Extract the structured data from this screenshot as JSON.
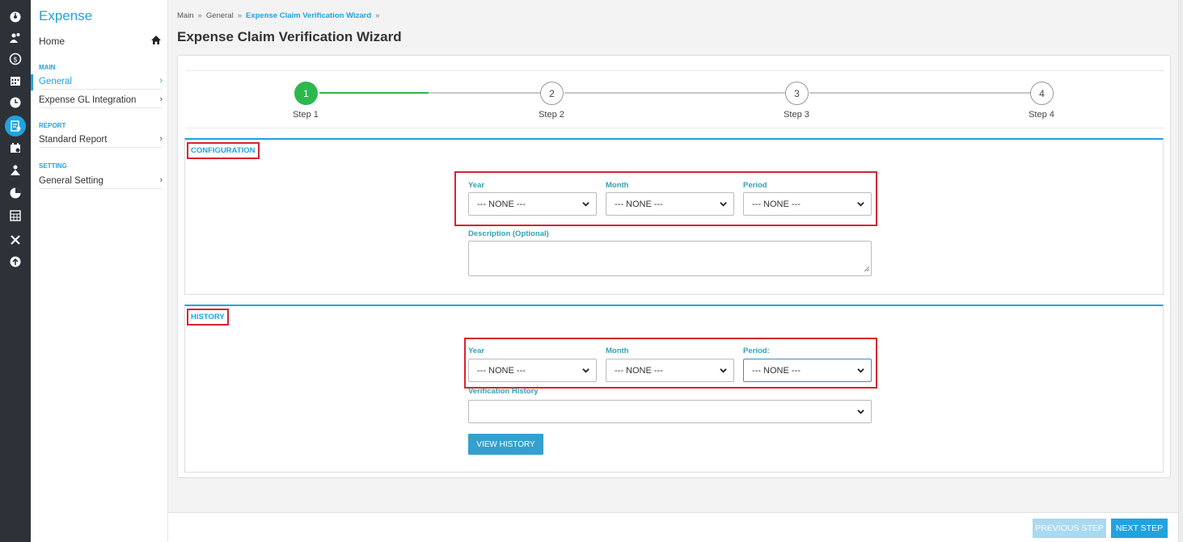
{
  "rail": {
    "icons": [
      "dashboard-icon",
      "users-icon",
      "money-icon",
      "calendar-icon",
      "clock-icon",
      "expense-claim-icon",
      "planner-icon",
      "org-icon",
      "chart-icon",
      "calculator-icon",
      "tools-icon",
      "upload-icon"
    ],
    "active_index": 5,
    "active_color": "#1fa3e0"
  },
  "menu": {
    "title": "Expense",
    "home": "Home",
    "sections": [
      {
        "heading": "MAIN",
        "items": [
          {
            "label": "General",
            "active": true
          },
          {
            "label": "Expense GL Integration"
          }
        ]
      },
      {
        "heading": "REPORT",
        "items": [
          {
            "label": "Standard Report"
          }
        ]
      },
      {
        "heading": "SETTING",
        "items": [
          {
            "label": "General Setting"
          }
        ]
      }
    ]
  },
  "breadcrumb": {
    "items": [
      "Main",
      "General",
      "Expense Claim Verification Wizard"
    ],
    "sep": "»"
  },
  "page_title": "Expense Claim Verification Wizard",
  "wizard": {
    "steps": [
      {
        "number": "1",
        "label": "Step 1",
        "active": true
      },
      {
        "number": "2",
        "label": "Step 2"
      },
      {
        "number": "3",
        "label": "Step 3"
      },
      {
        "number": "4",
        "label": "Step 4"
      }
    ],
    "progress_color": "#2db84d"
  },
  "configuration": {
    "title": "CONFIGURATION",
    "year_label": "Year",
    "month_label": "Month",
    "period_label": "Period",
    "year_value": "--- NONE ---",
    "month_value": "--- NONE ---",
    "period_value": "--- NONE ---",
    "description_label": "Description (Optional)"
  },
  "history": {
    "title": "HISTORY",
    "year_label": "Year",
    "month_label": "Month",
    "period_label": "Period:",
    "year_value": "--- NONE ---",
    "month_value": "--- NONE ---",
    "period_value": "--- NONE ---",
    "verification_label": "Verification History",
    "verification_value": "",
    "view_button": "VIEW HISTORY"
  },
  "footer": {
    "prev": "PREVIOUS STEP",
    "next": "NEXT STEP"
  },
  "colors": {
    "accent": "#1fa3e0",
    "highlight": "#d9232e",
    "label": "#35a0b4"
  }
}
